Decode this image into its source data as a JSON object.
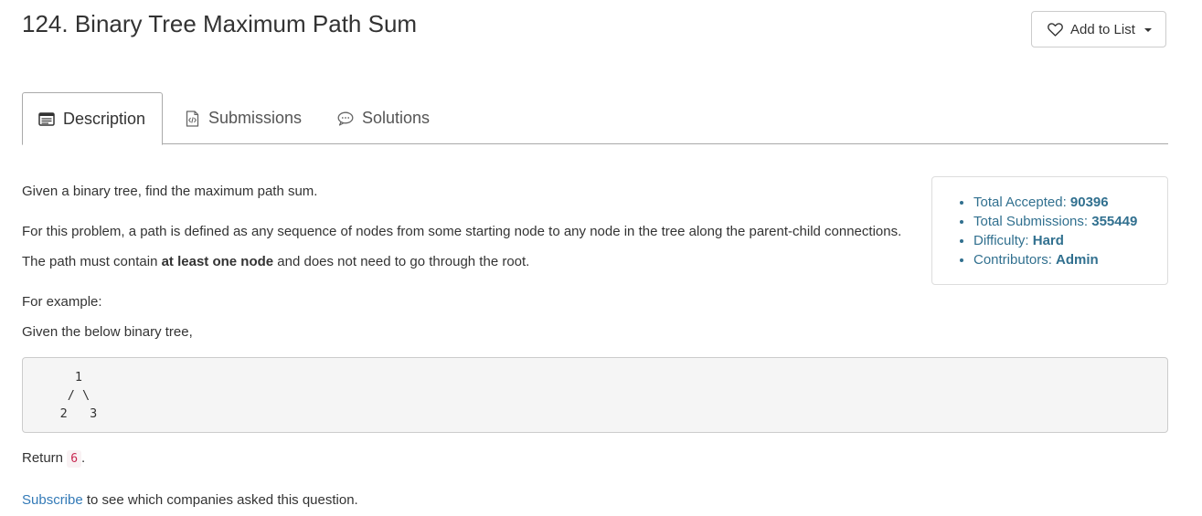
{
  "problem": {
    "title": "124. Binary Tree Maximum Path Sum"
  },
  "actions": {
    "add_to_list_label": "Add to List"
  },
  "tabs": [
    {
      "label": "Description",
      "icon": "description-icon",
      "active": true
    },
    {
      "label": "Submissions",
      "icon": "code-file-icon",
      "active": false
    },
    {
      "label": "Solutions",
      "icon": "chat-bubble-icon",
      "active": false
    }
  ],
  "description": {
    "intro": "Given a binary tree, find the maximum path sum.",
    "definition": "For this problem, a path is defined as any sequence of nodes from some starting node to any node in the tree along the parent-child connections.",
    "constraint_prefix": "The path must contain ",
    "constraint_bold": "at least one node",
    "constraint_suffix": " and does not need to go through the root.",
    "example_label": "For example:",
    "example_intro": "Given the below binary tree,",
    "tree_code": "       1\n      / \\\n     2   3",
    "return_prefix": "Return ",
    "return_value": "6",
    "return_suffix": ".",
    "subscribe_link": "Subscribe",
    "subscribe_suffix": " to see which companies asked this question."
  },
  "stats": {
    "accepted_label": "Total Accepted: ",
    "accepted_value": "90396",
    "submissions_label": "Total Submissions: ",
    "submissions_value": "355449",
    "difficulty_label": "Difficulty: ",
    "difficulty_value": "Hard",
    "contributors_label": "Contributors: ",
    "contributors_value": "Admin"
  },
  "colors": {
    "stat_text": "#31708f",
    "link": "#337ab7",
    "code_bg": "#f5f5f5",
    "inline_code": "#c7254e"
  }
}
